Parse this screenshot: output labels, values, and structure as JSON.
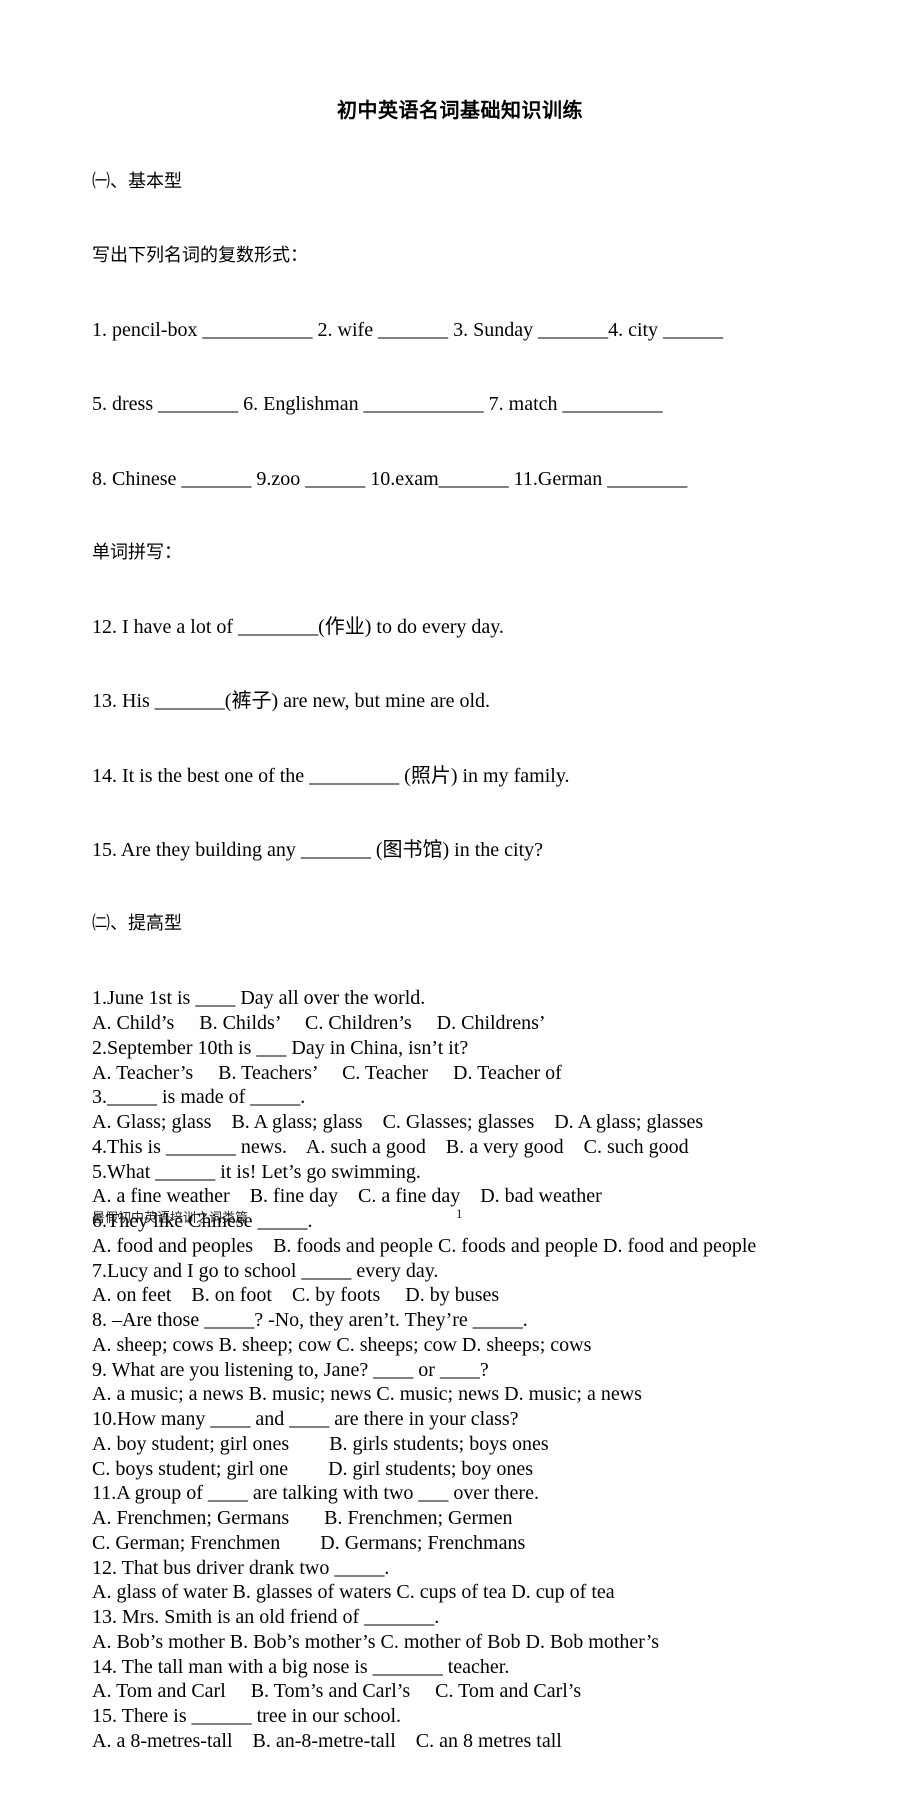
{
  "document": {
    "title": "初中英语名词基础知识训练",
    "section1": {
      "heading": "㈠、基本型",
      "instruction_plural": "写出下列名词的复数形式：",
      "plural_lines": [
        "1. pencil-box ___________ 2. wife _______ 3. Sunday _______4. city ______",
        "5. dress ________ 6. Englishman ____________ 7. match __________",
        "8. Chinese _______ 9.zoo ______ 10.exam_______ 11.German ________"
      ],
      "instruction_spelling": "单词拼写：",
      "spelling_lines": [
        "12. I have a lot of ________(作业) to do every day.",
        "13. His _______(裤子) are new, but mine are old.",
        "14. It is the best one of the _________ (照片) in my family.",
        "15. Are they building any _______ (图书馆) in the city?"
      ]
    },
    "section2": {
      "heading": "㈡、提高型",
      "lines": [
        "1.June 1st is ____ Day all over the world.",
        "A. Child’s     B. Childs’     C. Children’s     D. Childrens’",
        "2.September 10th is ___ Day in China, isn’t it?",
        "A. Teacher’s     B. Teachers’     C. Teacher     D. Teacher of",
        "3._____ is made of _____.",
        "A. Glass; glass    B. A glass; glass    C. Glasses; glasses    D. A glass; glasses",
        "4.This is _______ news.    A. such a good    B. a very good    C. such good",
        "5.What ______ it is! Let’s go swimming.",
        "A. a fine weather    B. fine day    C. a fine day    D. bad weather",
        "6.They like Chinese _____.",
        "A. food and peoples    B. foods and people C. foods and people D. food and people",
        "7.Lucy and I go to school _____ every day.",
        "A. on feet    B. on foot    C. by foots     D. by buses",
        "8. –Are those _____? -No, they aren’t. They’re _____.",
        "A. sheep; cows B. sheep; cow C. sheeps; cow D. sheeps; cows",
        "9. What are you listening to, Jane? ____ or ____?",
        "A. a music; a news B. music; news C. music; news D. music; a news",
        "10.How many ____ and ____ are there in your class?",
        "A. boy student; girl ones        B. girls students; boys ones",
        "C. boys student; girl one        D. girl students; boy ones",
        "11.A group of ____ are talking with two ___ over there.",
        "A. Frenchmen; Germans       B. Frenchmen; Germen",
        "C. German; Frenchmen        D. Germans; Frenchmans",
        "12. That bus driver drank two _____.",
        "A. glass of water B. glasses of waters C. cups of tea D. cup of tea",
        "13. Mrs. Smith is an old friend of _______.",
        "A. Bob’s mother B. Bob’s mother’s C. mother of Bob D. Bob mother’s",
        "14. The tall man with a big nose is _______ teacher.",
        "A. Tom and Carl     B. Tom’s and Carl’s     C. Tom and Carl’s",
        "15. There is ______ tree in our school.",
        "A. a 8-metres-tall    B. an-8-metre-tall    C. an 8 metres tall"
      ]
    }
  },
  "footer": {
    "left_text": "暑假初中英语培训之词类篇",
    "page_number": "1"
  }
}
